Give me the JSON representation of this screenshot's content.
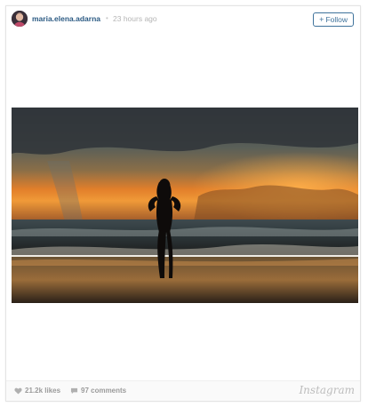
{
  "post": {
    "username": "maria.elena.adarna",
    "separator": "•",
    "timestamp": "23 hours ago",
    "follow_label": "Follow",
    "follow_symbol": "+"
  },
  "stats": {
    "likes": "21.2k likes",
    "comments": "97 comments"
  },
  "branding": {
    "logo_text": "Instagram"
  },
  "colors": {
    "link_blue": "#2b5a83",
    "follow_blue": "#3f729b",
    "muted_gray": "#9b9b9b"
  },
  "icons": {
    "likes": "heart-icon",
    "comments": "speech-bubble-icon"
  }
}
